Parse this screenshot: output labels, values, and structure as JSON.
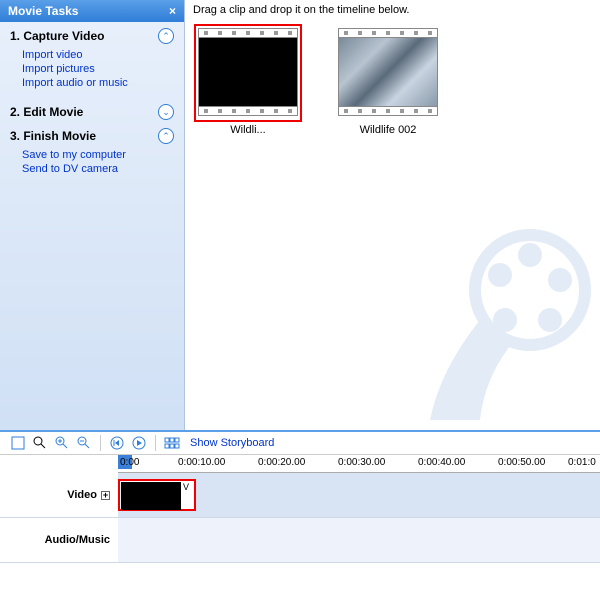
{
  "sidebar": {
    "title": "Movie Tasks",
    "sections": [
      {
        "title": "1. Capture Video",
        "links": [
          "Import video",
          "Import pictures",
          "Import audio or music"
        ]
      },
      {
        "title": "2. Edit Movie",
        "links": []
      },
      {
        "title": "3. Finish Movie",
        "links": [
          "Save to my computer",
          "Send to DV camera"
        ]
      }
    ]
  },
  "content": {
    "hint": "Drag a clip and drop it on the timeline below.",
    "clips": [
      {
        "label": "Wildli...",
        "selected": true,
        "style": "black"
      },
      {
        "label": "Wildlife 002",
        "selected": false,
        "style": "wildlife"
      }
    ]
  },
  "toolbar": {
    "storyboard": "Show Storyboard"
  },
  "timeline": {
    "marks": [
      "0:00",
      "0:00:10.00",
      "0:00:20.00",
      "0:00:30.00",
      "0:00:40.00",
      "0:00:50.00",
      "0:01:0"
    ],
    "tracks": {
      "video": "Video",
      "audio": "Audio/Music"
    },
    "clip_letter": "V"
  }
}
